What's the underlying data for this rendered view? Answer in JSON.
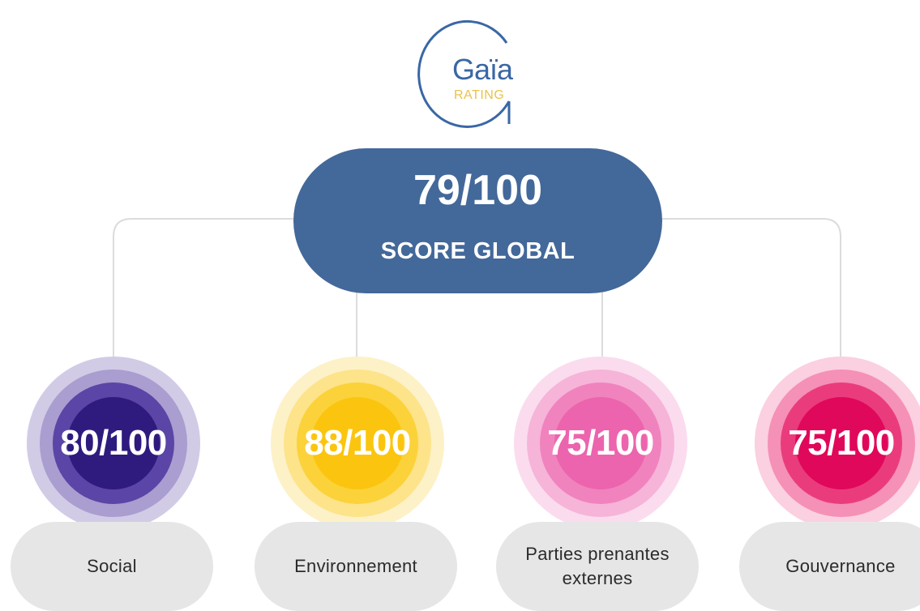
{
  "logo": {
    "name": "Gaïa",
    "subtitle": "RATING",
    "ring_color": "#3a67a5",
    "subtitle_color": "#e8c34a"
  },
  "global": {
    "score": "79/100",
    "label": "SCORE GLOBAL",
    "color": "#43689a"
  },
  "pillars": [
    {
      "score": "80/100",
      "label": "Social",
      "colors": [
        "#d2cbe6",
        "#aa9dd0",
        "#5b45a6",
        "#2f1b7d"
      ]
    },
    {
      "score": "88/100",
      "label": "Environnement",
      "colors": [
        "#fdf1c8",
        "#fde38a",
        "#fcd23a",
        "#fbc50f"
      ]
    },
    {
      "score": "75/100",
      "label": "Parties prenantes externes",
      "colors": [
        "#fbdcee",
        "#f6b4d8",
        "#f083bd",
        "#ec64ad"
      ]
    },
    {
      "score": "75/100",
      "label": "Gouvernance",
      "colors": [
        "#fbd0e0",
        "#f590b6",
        "#ea3c7d",
        "#e0085a"
      ]
    }
  ]
}
